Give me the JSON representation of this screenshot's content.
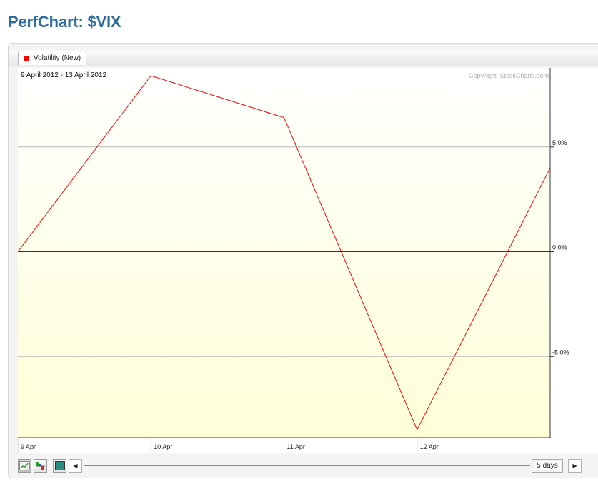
{
  "page": {
    "title": "PerfChart: $VIX"
  },
  "legend": {
    "label": "Volatility (New)",
    "color": "#ff0000"
  },
  "chart_header": {
    "date_range": "9 April 2012 - 13 April 2012",
    "copyright": "Copyright, StockCharts.com"
  },
  "chart_data": {
    "type": "line",
    "series": [
      {
        "name": "Volatility (New)",
        "color": "#ff0000",
        "x": [
          "9 Apr",
          "10 Apr",
          "11 Apr",
          "12 Apr",
          "13 Apr"
        ],
        "values": [
          0.0,
          8.4,
          6.4,
          -8.5,
          4.0
        ]
      }
    ],
    "x_tick_labels": [
      "9 Apr",
      "10 Apr",
      "11 Apr",
      "12 Apr"
    ],
    "y_tick_labels": [
      "5.0%",
      "0.0%",
      "-5.0%"
    ],
    "y_ticks": [
      5.0,
      0.0,
      -5.0
    ],
    "ylim": [
      -8.5,
      8.4
    ],
    "grid": true,
    "background_gradient": [
      "#ffffff",
      "#ffffd8"
    ],
    "grid_color": "#b5b5b5",
    "zero_line_color": "#333333"
  },
  "controls": {
    "period_label": "5 days",
    "buttons": [
      "line-chart-icon",
      "histogram-icon",
      "fill-toggle-icon"
    ],
    "scroll_left": "◀",
    "scroll_right": "▶"
  }
}
